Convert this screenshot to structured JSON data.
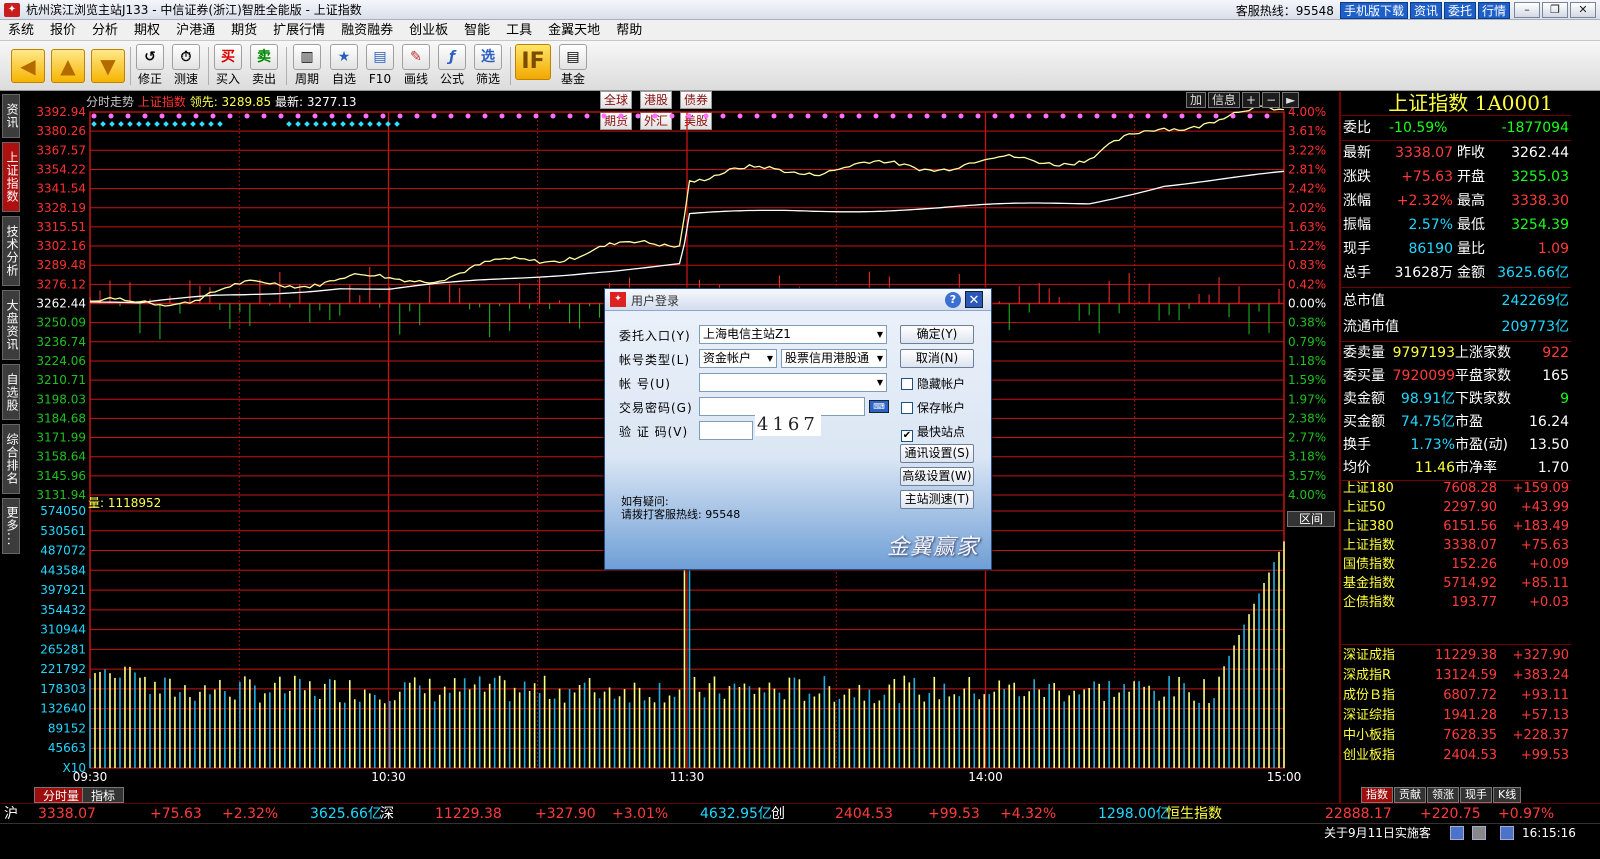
{
  "window": {
    "title": "杭州滨江浏览主站J133 - 中信证券(浙江)智胜全能版 - 上证指数",
    "hotline_label": "客服热线：95548",
    "links": [
      "手机版下载",
      "资讯",
      "委托",
      "行情"
    ]
  },
  "menu": [
    "系统",
    "报价",
    "分析",
    "期权",
    "沪港通",
    "期货",
    "扩展行情",
    "融资融券",
    "创业板",
    "智能",
    "工具",
    "金翼天地",
    "帮助"
  ],
  "toolbar": {
    "tools": [
      {
        "label": "修正",
        "glyph": "↺"
      },
      {
        "label": "测速",
        "glyph": "⏱"
      },
      {
        "label": "买入",
        "glyph": "买"
      },
      {
        "label": "卖出",
        "glyph": "卖"
      },
      {
        "label": "周期",
        "glyph": "▥"
      },
      {
        "label": "自选",
        "glyph": "★"
      },
      {
        "label": "F10",
        "glyph": "▤"
      },
      {
        "label": "画线",
        "glyph": "✎"
      },
      {
        "label": "公式",
        "glyph": "ƒ"
      },
      {
        "label": "筛选",
        "glyph": "选"
      },
      {
        "label": "基金",
        "glyph": "▤"
      }
    ],
    "if_glyph": "IF",
    "mini": [
      "全球",
      "港股",
      "债券",
      "期货",
      "外汇",
      "美股"
    ]
  },
  "left_tabs": [
    "资讯",
    "上证指数",
    "技术分析",
    "大盘资讯",
    "自选股",
    "综合排名",
    "更多..."
  ],
  "chart": {
    "header": {
      "title": "分时走势",
      "index": "上证指数",
      "leader": "领先: 3289.85",
      "last": "最新: 3277.13"
    },
    "tools": [
      "加",
      "信息",
      "+",
      "−",
      "►"
    ],
    "volume_label": "量: 1118952",
    "range_button": "区间",
    "price_ticks": [
      "3392.94",
      "3380.26",
      "3367.57",
      "3354.22",
      "3341.54",
      "3328.19",
      "3315.51",
      "3302.16",
      "3289.48",
      "3276.12",
      "3262.44",
      "3250.09",
      "3236.74",
      "3224.06",
      "3210.71",
      "3198.03",
      "3184.68",
      "3171.99",
      "3158.64",
      "3145.96",
      "3131.94"
    ],
    "pct_ticks": [
      "4.00%",
      "3.61%",
      "3.22%",
      "2.81%",
      "2.42%",
      "2.02%",
      "1.63%",
      "1.22%",
      "0.83%",
      "0.42%",
      "0.00%",
      "0.38%",
      "0.79%",
      "1.18%",
      "1.59%",
      "1.97%",
      "2.38%",
      "2.77%",
      "3.18%",
      "3.57%",
      "4.00%"
    ],
    "vol_ticks": [
      "574050",
      "530561",
      "487072",
      "443584",
      "397921",
      "354432",
      "310944",
      "265281",
      "221792",
      "178303",
      "132640",
      "89152",
      "45663",
      "X10"
    ],
    "time_ticks": [
      "09:30",
      "10:30",
      "11:30",
      "14:00",
      "15:00"
    ],
    "colors": {
      "price": "#ffffa0",
      "avg": "#ffffff",
      "grid": "#c81414",
      "up": "#ff3030",
      "down": "#20c020"
    }
  },
  "bottom_tabs": [
    "分时量",
    "指标"
  ],
  "right_panel": {
    "title": "上证指数 1A0001",
    "rows": [
      {
        "l1": "委比",
        "v1": "-10.59%",
        "l2": "",
        "v2": "-1877094"
      },
      {
        "l1": "最新",
        "v1": "3338.07",
        "l2": "昨收",
        "v2": "3262.44"
      },
      {
        "l1": "涨跌",
        "v1": "+75.63",
        "l2": "开盘",
        "v2": "3255.03"
      },
      {
        "l1": "涨幅",
        "v1": "+2.32%",
        "l2": "最高",
        "v2": "3338.30"
      },
      {
        "l1": "振幅",
        "v1": "2.57%",
        "l2": "最低",
        "v2": "3254.39"
      },
      {
        "l1": "现手",
        "v1": "86190",
        "l2": "量比",
        "v2": "1.09"
      },
      {
        "l1": "总手",
        "v1": "31628万",
        "l2": "金额",
        "v2": "3625.66亿"
      }
    ],
    "caps": [
      {
        "l": "总市值",
        "v": "242269亿"
      },
      {
        "l": "流通市值",
        "v": "209773亿"
      }
    ],
    "stats": [
      {
        "l1": "委卖量",
        "v1": "9797193",
        "l2": "上涨家数",
        "v2": "922"
      },
      {
        "l1": "委买量",
        "v1": "7920099",
        "l2": "平盘家数",
        "v2": "165"
      },
      {
        "l1": "卖金额",
        "v1": "98.91亿",
        "l2": "下跌家数",
        "v2": "9"
      },
      {
        "l1": "买金额",
        "v1": "74.75亿",
        "l2": "市盈",
        "v2": "16.24"
      },
      {
        "l1": "换手",
        "v1": "1.73%",
        "l2": "市盈(动)",
        "v2": "13.50"
      },
      {
        "l1": "均价",
        "v1": "11.46",
        "l2": "市净率",
        "v2": "1.70"
      }
    ],
    "sh_indices": [
      {
        "name": "上证180",
        "price": "7608.28",
        "chg": "+159.09"
      },
      {
        "name": "上证50",
        "price": "2297.90",
        "chg": "+43.99"
      },
      {
        "name": "上证380",
        "price": "6151.56",
        "chg": "+183.49"
      },
      {
        "name": "上证指数",
        "price": "3338.07",
        "chg": "+75.63"
      },
      {
        "name": "国债指数",
        "price": "152.26",
        "chg": "+0.09"
      },
      {
        "name": "基金指数",
        "price": "5714.92",
        "chg": "+85.11"
      },
      {
        "name": "企债指数",
        "price": "193.77",
        "chg": "+0.03"
      }
    ],
    "sz_indices": [
      {
        "name": "深证成指",
        "price": "11229.38",
        "chg": "+327.90"
      },
      {
        "name": "深成指R",
        "price": "13124.59",
        "chg": "+383.24"
      },
      {
        "name": "成份Ｂ指",
        "price": "6807.72",
        "chg": "+93.11"
      },
      {
        "name": "深证综指",
        "price": "1941.28",
        "chg": "+57.13"
      },
      {
        "name": "中小板指",
        "price": "7628.35",
        "chg": "+228.37"
      },
      {
        "name": "创业板指",
        "price": "2404.53",
        "chg": "+99.53"
      }
    ],
    "bottom_tabs": [
      "指数",
      "贡献",
      "领涨",
      "现手",
      "K线"
    ]
  },
  "ticker": {
    "sh_label": "沪",
    "sh_price": "3338.07",
    "sh_chg": "+75.63",
    "sh_pct": "+2.32%",
    "sh_amt": "3625.66亿",
    "sz_label": "深",
    "sz_price": "11229.38",
    "sz_chg": "+327.90",
    "sz_pct": "+3.01%",
    "sz_amt": "4632.95亿",
    "cy_label": "创",
    "cy_price": "2404.53",
    "cy_chg": "+99.53",
    "cy_pct": "+4.32%",
    "cy_amt": "1298.00亿",
    "hs_label": "恒生指数",
    "hs_price": "22888.17",
    "hs_chg": "+220.75",
    "hs_pct": "+0.97%"
  },
  "status": {
    "news": "关于9月11日实施客",
    "clock": "16:15:16"
  },
  "dialog": {
    "title": "用户登录",
    "help": "?",
    "close": "✕",
    "entry_label": "委托入口(Y)",
    "entry_value": "上海电信主站Z1",
    "acct_type_label": "帐号类型(L)",
    "acct_type_value": "资金帐户",
    "acct_type_value2": "股票信用港股通",
    "acct_label": "帐    号(U)",
    "pwd_label": "交易密码(G)",
    "captcha_label": "验 证 码(V)",
    "captcha": "4167",
    "kbd_icon": "⌨",
    "ok": "确定(Y)",
    "cancel": "取消(N)",
    "hide_acct": "隐藏帐户",
    "save_acct": "保存帐户",
    "fastest_site": "最快站点",
    "comm_settings": "通讯设置(S)",
    "adv_settings": "高级设置(W)",
    "speed_test": "主站测速(T)",
    "help_text_1": "如有疑问:",
    "help_text_2": "请拨打客服热线: 95548",
    "brand": "金翼赢家"
  }
}
